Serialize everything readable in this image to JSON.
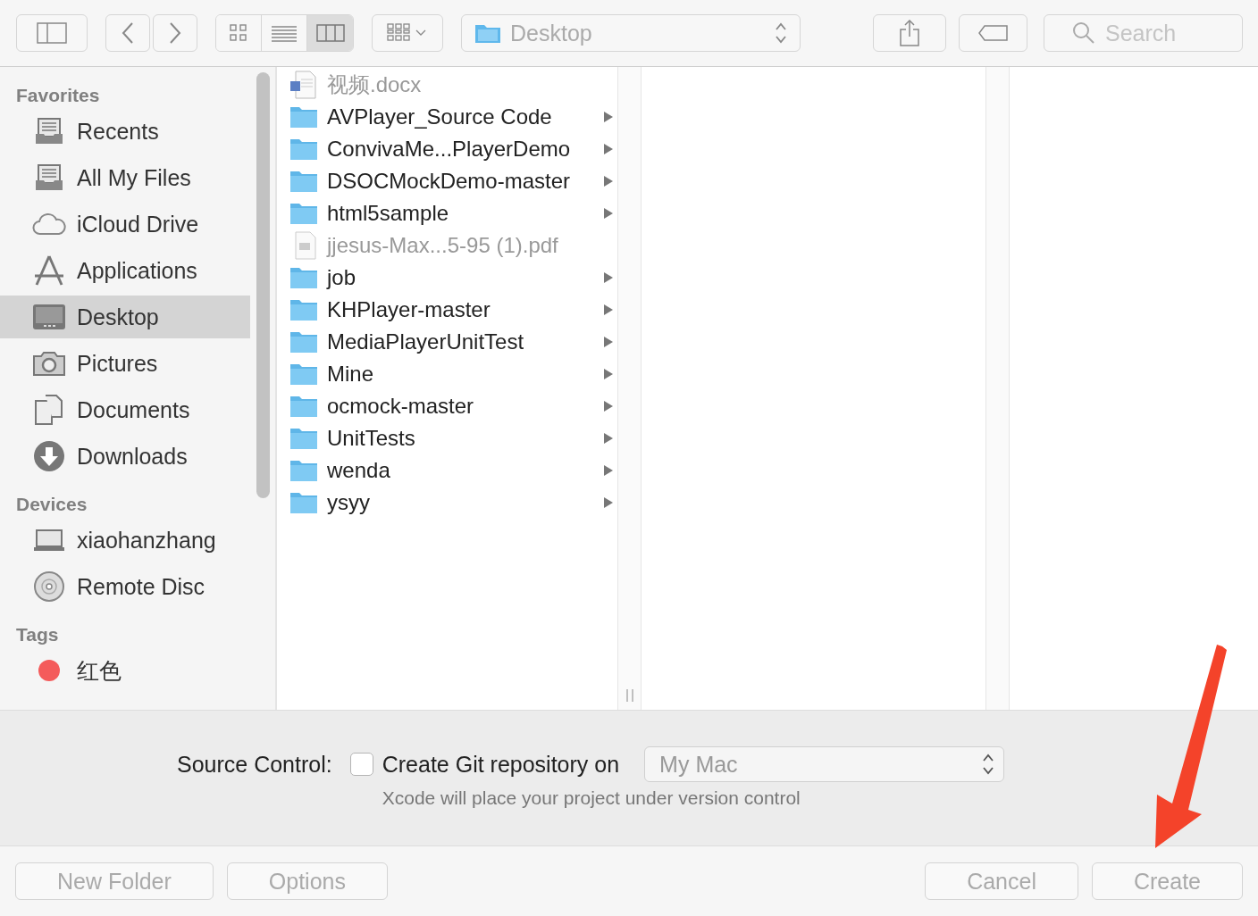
{
  "toolbar": {
    "view_modes": [
      {
        "kind": "icons",
        "selected": false
      },
      {
        "kind": "list",
        "selected": false
      },
      {
        "kind": "columns",
        "selected": true
      }
    ],
    "location": "Desktop",
    "search": {
      "placeholder": "Search"
    }
  },
  "sidebar": {
    "sections": [
      {
        "title": "Favorites",
        "items": [
          {
            "label": "Recents",
            "kind": "recents",
            "selected": false
          },
          {
            "label": "All My Files",
            "kind": "all-files",
            "selected": false
          },
          {
            "label": "iCloud Drive",
            "kind": "icloud",
            "selected": false
          },
          {
            "label": "Applications",
            "kind": "applications",
            "selected": false
          },
          {
            "label": "Desktop",
            "kind": "desktop",
            "selected": true
          },
          {
            "label": "Pictures",
            "kind": "pictures",
            "selected": false
          },
          {
            "label": "Documents",
            "kind": "documents",
            "selected": false
          },
          {
            "label": "Downloads",
            "kind": "downloads",
            "selected": false
          }
        ]
      },
      {
        "title": "Devices",
        "items": [
          {
            "label": "xiaohanzhang",
            "kind": "computer",
            "selected": false
          },
          {
            "label": "Remote Disc",
            "kind": "disc",
            "selected": false
          }
        ]
      },
      {
        "title": "Tags",
        "items": [
          {
            "label": "红色",
            "kind": "tag",
            "color": "#f45b5b",
            "selected": false
          }
        ]
      }
    ]
  },
  "files": [
    {
      "name": "视频.docx",
      "kind": "document",
      "disabled": true
    },
    {
      "name": "AVPlayer_Source Code",
      "kind": "folder",
      "disabled": false
    },
    {
      "name": "ConvivaMe...PlayerDemo",
      "kind": "folder",
      "disabled": false
    },
    {
      "name": "DSOCMockDemo-master",
      "kind": "folder",
      "disabled": false
    },
    {
      "name": "html5sample",
      "kind": "folder",
      "disabled": false
    },
    {
      "name": "jjesus-Max...5-95 (1).pdf",
      "kind": "pdf",
      "disabled": true
    },
    {
      "name": "job",
      "kind": "folder",
      "disabled": false
    },
    {
      "name": "KHPlayer-master",
      "kind": "folder",
      "disabled": false
    },
    {
      "name": "MediaPlayerUnitTest",
      "kind": "folder",
      "disabled": false
    },
    {
      "name": "Mine",
      "kind": "folder",
      "disabled": false
    },
    {
      "name": "ocmock-master",
      "kind": "folder",
      "disabled": false
    },
    {
      "name": "UnitTests",
      "kind": "folder",
      "disabled": false
    },
    {
      "name": "wenda",
      "kind": "folder",
      "disabled": false
    },
    {
      "name": "ysyy",
      "kind": "folder",
      "disabled": false
    }
  ],
  "source_control": {
    "label": "Source Control:",
    "checkbox": {
      "label": "Create Git repository on",
      "checked": false
    },
    "target": "My Mac",
    "hint": "Xcode will place your project under version control"
  },
  "footer_left_buttons": [
    {
      "label": "New Folder",
      "disabled": true
    },
    {
      "label": "Options",
      "disabled": true
    }
  ],
  "footer_right_buttons": [
    {
      "label": "Cancel",
      "disabled": true
    },
    {
      "label": "Create",
      "disabled": true
    }
  ]
}
